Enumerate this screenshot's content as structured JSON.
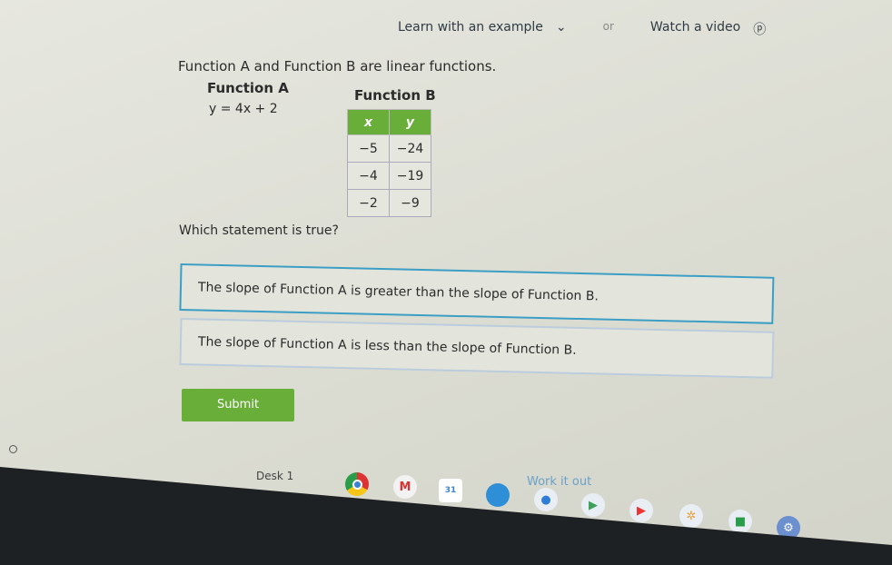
{
  "header": {
    "learn_label": "Learn with an example",
    "or_label": "or",
    "video_label": "Watch a video"
  },
  "problem": {
    "intro": "Function A and Function B are linear functions.",
    "function_a": {
      "title": "Function A",
      "equation": "y = 4x + 2"
    },
    "function_b": {
      "title": "Function B",
      "headers": [
        "x",
        "y"
      ],
      "rows": [
        [
          "−5",
          "−24"
        ],
        [
          "−4",
          "−19"
        ],
        [
          "−2",
          "−9"
        ]
      ]
    },
    "question": "Which statement is true?",
    "options": [
      "The slope of Function A is greater than the slope of Function B.",
      "The slope of Function A is less than the slope of Function B."
    ],
    "selected_option": 0,
    "submit_label": "Submit"
  },
  "shelf": {
    "desk_label": "Desk 1",
    "work_label": "Work it out",
    "apps": [
      "chrome-icon",
      "gmail-icon",
      "calendar-icon",
      "files-icon",
      "messages-icon",
      "play-store-icon",
      "youtube-icon",
      "photos-icon",
      "meet-icon",
      "settings-icon"
    ]
  },
  "colors": {
    "accent_green": "#6aae3a",
    "selected_border": "#3b9ec4"
  }
}
